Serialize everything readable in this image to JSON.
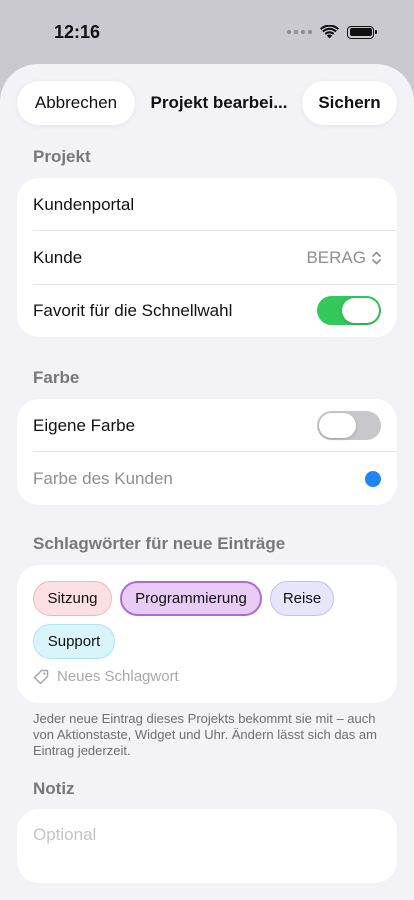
{
  "status_bar": {
    "time": "12:16"
  },
  "nav": {
    "cancel_label": "Abbrechen",
    "title": "Projekt bearbei...",
    "save_label": "Sichern"
  },
  "projekt": {
    "header": "Projekt",
    "name": "Kundenportal",
    "customer_label": "Kunde",
    "customer_value": "BERAG",
    "favorite_label": "Favorit für die Schnellwahl",
    "favorite_on": true
  },
  "farbe": {
    "header": "Farbe",
    "custom_label": "Eigene Farbe",
    "custom_on": false,
    "customer_color_label": "Farbe des Kunden",
    "customer_color": "#1f85f5"
  },
  "tags": {
    "header": "Schlagwörter für neue Einträge",
    "items": [
      "Sitzung",
      "Programmierung",
      "Reise",
      "Support"
    ],
    "new_placeholder": "Neues Schlagwort",
    "footnote": "Jeder neue Eintrag dieses Projekts bekommt sie mit – auch von Aktionstaste, Widget und Uhr. Ändern lässt sich das am Eintrag jederzeit."
  },
  "notiz": {
    "header": "Notiz",
    "placeholder": "Optional"
  }
}
